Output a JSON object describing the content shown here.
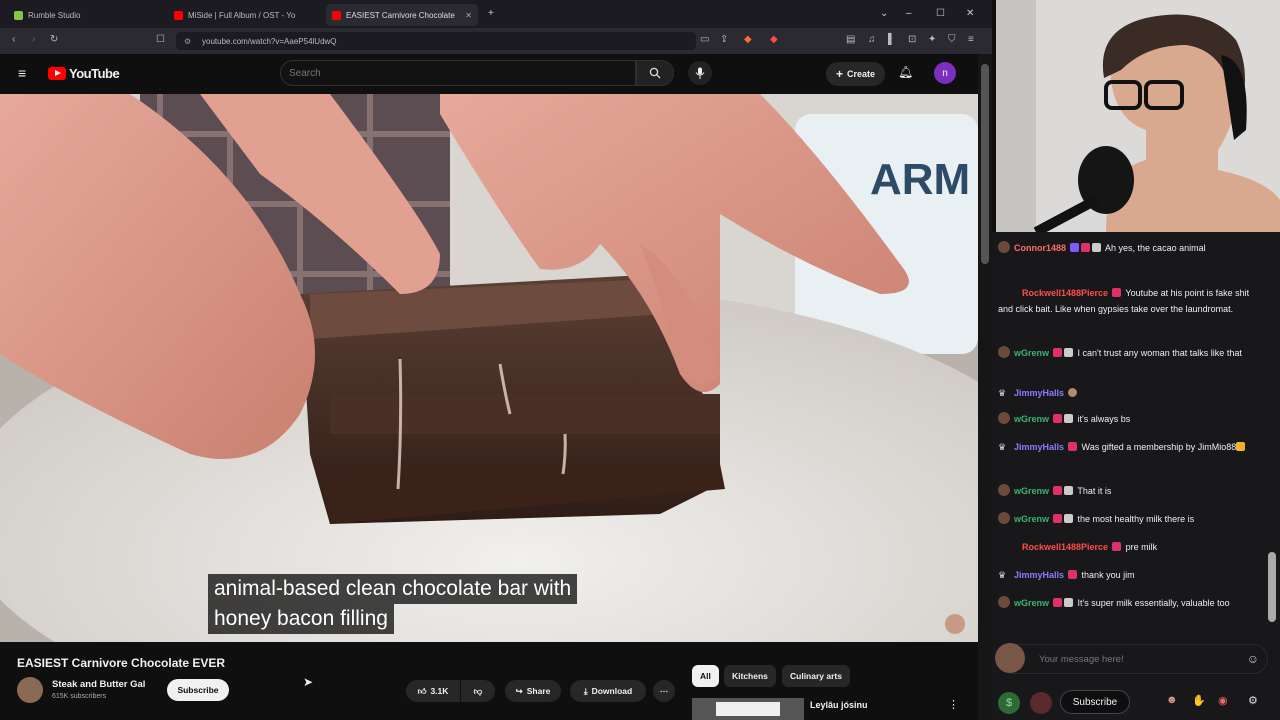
{
  "browser": {
    "tabs": [
      {
        "label": "Rumble Studio",
        "color": "#85c742",
        "active": false
      },
      {
        "label": "MiSide | Full Album / OST - Yo",
        "color": "#ff0000",
        "active": false
      },
      {
        "label": "EASIEST Carnivore Chocolate",
        "color": "#ff0000",
        "active": true
      }
    ],
    "url": "youtube.com/watch?v=AaeP54lUdwQ"
  },
  "youtube": {
    "logo_text": "YouTube",
    "search_placeholder": "Search",
    "create_label": "Create",
    "avatar_letter": "n",
    "caption_line1": "animal-based clean chocolate bar with",
    "caption_line2": "honey bacon filling",
    "video_title": "EASIEST Carnivore Chocolate EVER",
    "channel_name": "Steak and Butter Gal",
    "channel_subs": "615K subscribers",
    "subscribe_label": "Subscribe",
    "likes": "3.1K",
    "share_label": "Share",
    "download_label": "Download",
    "chips": [
      "All",
      "Kitchens",
      "Culinary arts"
    ],
    "recommended_title": "Leylâu jósinu"
  },
  "chat": {
    "messages": [
      {
        "user": "Connor1488",
        "color": "#ff6b6b",
        "text": "Ah yes, the cacao animal"
      },
      {
        "user": "Rockwell1488Pierce",
        "color": "#ff4d4d",
        "text": "Youtube at his point is fake shit and click bait. Like when gypsies take over the laundromat."
      },
      {
        "user": "wGrenw",
        "color": "#3cb371",
        "text": "I can't trust any woman that talks like that"
      },
      {
        "user": "JimmyHalls",
        "color": "#8a7cff",
        "text": ""
      },
      {
        "user": "wGrenw",
        "color": "#3cb371",
        "text": "it's always bs"
      },
      {
        "user": "JimmyHalls",
        "color": "#8a7cff",
        "text": "Was gifted a membership by JimMio88"
      },
      {
        "user": "wGrenw",
        "color": "#3cb371",
        "text": "That it is"
      },
      {
        "user": "wGrenw",
        "color": "#3cb371",
        "text": "the most healthy milk there is"
      },
      {
        "user": "Rockwell1488Pierce",
        "color": "#ff4d4d",
        "text": "pre milk"
      },
      {
        "user": "JimmyHalls",
        "color": "#8a7cff",
        "text": "thank you jim"
      },
      {
        "user": "wGrenw",
        "color": "#3cb371",
        "text": "It's super milk essentially, valuable too"
      }
    ],
    "input_placeholder": "Your message here!",
    "subscribe_label": "Subscribe"
  }
}
